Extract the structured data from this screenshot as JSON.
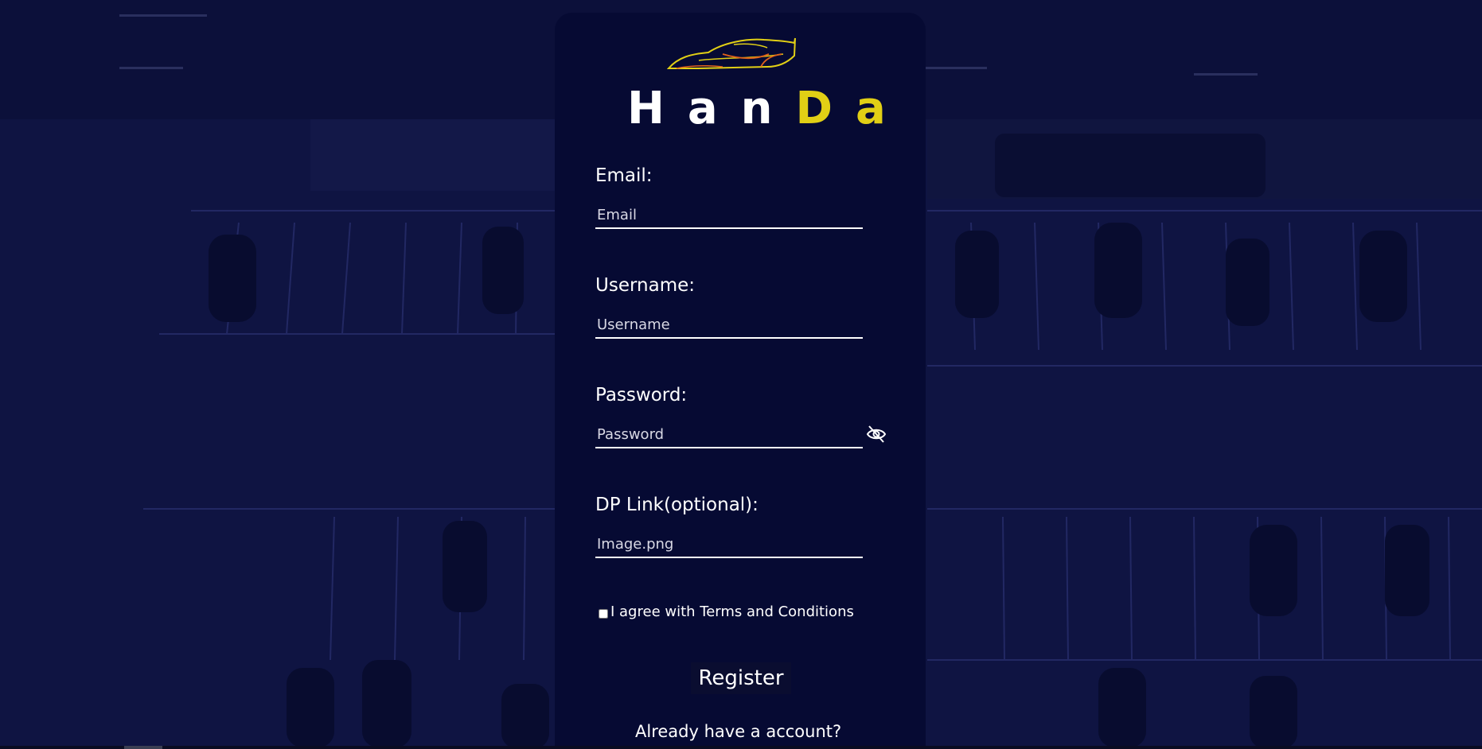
{
  "brand": {
    "logo_icon": "sports-car-outline-icon",
    "name_parts": [
      "HanD",
      "a"
    ],
    "name_white": "Han",
    "name_yellow_1": "D",
    "name_yellow_2": "a",
    "name_between": " ",
    "accent_color": "#e1cf15"
  },
  "form": {
    "email": {
      "label": "Email:",
      "placeholder": "Email",
      "value": ""
    },
    "username": {
      "label": "Username:",
      "placeholder": "Username",
      "value": ""
    },
    "password": {
      "label": "Password:",
      "placeholder": "Password",
      "value": "",
      "toggle_icon": "eye-slash-icon"
    },
    "dp_link": {
      "label": "DP Link(optional):",
      "placeholder": "Image.png",
      "value": ""
    },
    "terms": {
      "label": "I agree with Terms and Conditions",
      "checked": false
    },
    "register_label": "Register",
    "login_prompt": "Already have a account?"
  },
  "colors": {
    "panel": "#060a33",
    "background": "#0e1240",
    "text": "#ffffff"
  }
}
